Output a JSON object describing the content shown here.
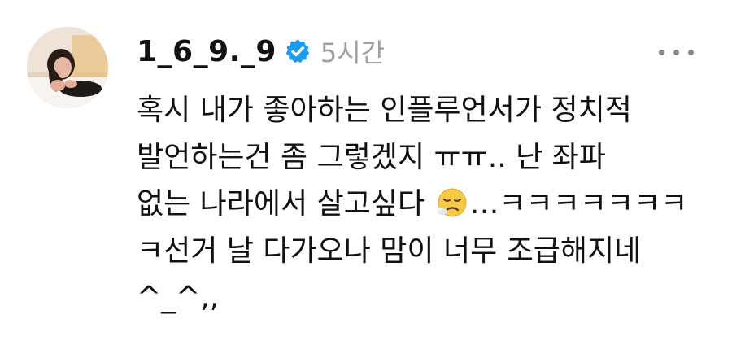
{
  "post": {
    "username": "1_6_9._9",
    "time": "5시간",
    "verified_color": "#1d9bf0",
    "icons": {
      "avatar": "profile-photo",
      "verified": "verified-badge-icon",
      "more": "more-options-icon",
      "emoji": "sad-relieved-face-emoji"
    },
    "body": {
      "line1": "혹시 내가 좋아하는 인플루언서가 정치적",
      "line2": "발언하는건 좀 그렇겠지 ㅠㅠ.. 난 좌파",
      "line3_before": "없는 나라에서 살고싶다 ",
      "line3_after": "…ㅋㅋㅋㅋㅋㅋㅋ",
      "line4": "ㅋ선거 날 다가오나 맘이 너무 조급해지네",
      "line5": "^_^,,"
    }
  }
}
